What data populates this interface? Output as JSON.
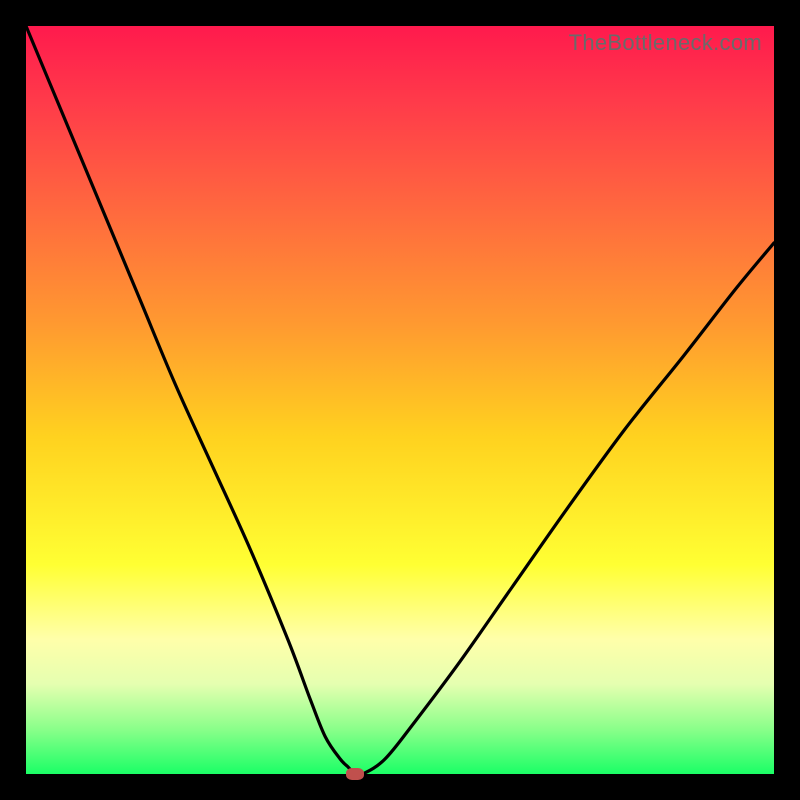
{
  "watermark": "TheBottleneck.com",
  "chart_data": {
    "type": "line",
    "title": "",
    "xlabel": "",
    "ylabel": "",
    "xlim": [
      0,
      100
    ],
    "ylim": [
      0,
      100
    ],
    "series": [
      {
        "name": "bottleneck-curve",
        "x": [
          0,
          5,
          10,
          15,
          20,
          25,
          30,
          35,
          38,
          40,
          42,
          43,
          44,
          45,
          48,
          52,
          58,
          65,
          72,
          80,
          88,
          95,
          100
        ],
        "y": [
          100,
          88,
          76,
          64,
          52,
          41,
          30,
          18,
          10,
          5,
          2,
          1,
          0,
          0,
          2,
          7,
          15,
          25,
          35,
          46,
          56,
          65,
          71
        ]
      }
    ],
    "marker": {
      "x": 44,
      "y": 0,
      "color": "#c0504d"
    },
    "gradient_stops": [
      {
        "pct": 0,
        "color": "#ff1a4d"
      },
      {
        "pct": 10,
        "color": "#ff3a4a"
      },
      {
        "pct": 25,
        "color": "#ff6a3e"
      },
      {
        "pct": 40,
        "color": "#ff9a30"
      },
      {
        "pct": 55,
        "color": "#ffd21f"
      },
      {
        "pct": 72,
        "color": "#ffff33"
      },
      {
        "pct": 82,
        "color": "#ffffaa"
      },
      {
        "pct": 88,
        "color": "#e5ffb0"
      },
      {
        "pct": 94,
        "color": "#8aff8a"
      },
      {
        "pct": 100,
        "color": "#1bff66"
      }
    ]
  }
}
